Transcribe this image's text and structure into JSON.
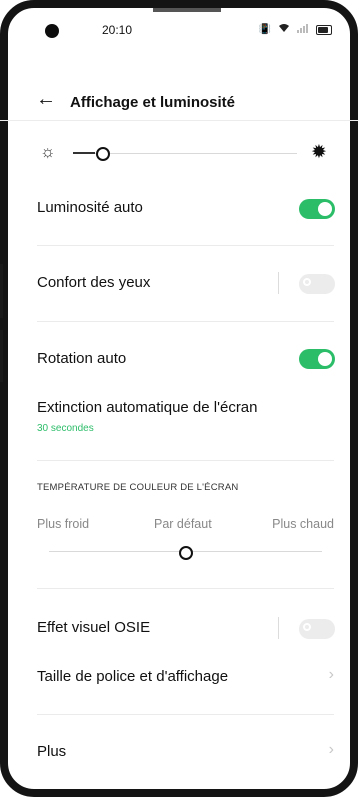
{
  "status_bar": {
    "time": "20:10",
    "icons": [
      "vibrate-icon",
      "wifi-icon",
      "signal-icon",
      "battery-icon"
    ]
  },
  "header": {
    "title": "Affichage et luminosité"
  },
  "brightness": {
    "level": 0.1,
    "icons": [
      "sun-small-icon",
      "sun-large-icon"
    ]
  },
  "settings": {
    "luminosite_auto": {
      "label": "Luminosité auto",
      "enabled": true
    },
    "confort_yeux": {
      "label": "Confort des yeux",
      "enabled": false
    },
    "rotation_auto": {
      "label": "Rotation auto",
      "enabled": true
    },
    "extinction": {
      "label": "Extinction automatique de l'écran",
      "value": "30 secondes"
    },
    "temperature": {
      "section_title": "TEMPÉRATURE DE COULEUR DE L'ÉCRAN",
      "cold_label": "Plus froid",
      "default_label": "Par défaut",
      "warm_label": "Plus chaud",
      "level": 0.5
    },
    "effet_osie": {
      "label": "Effet visuel OSIE",
      "enabled": false
    },
    "taille_police": {
      "label": "Taille de police et d'affichage"
    },
    "plus": {
      "label": "Plus"
    }
  },
  "colors": {
    "accent": "#2cbd69",
    "toggle_off": "#ececec",
    "text": "#111111"
  }
}
